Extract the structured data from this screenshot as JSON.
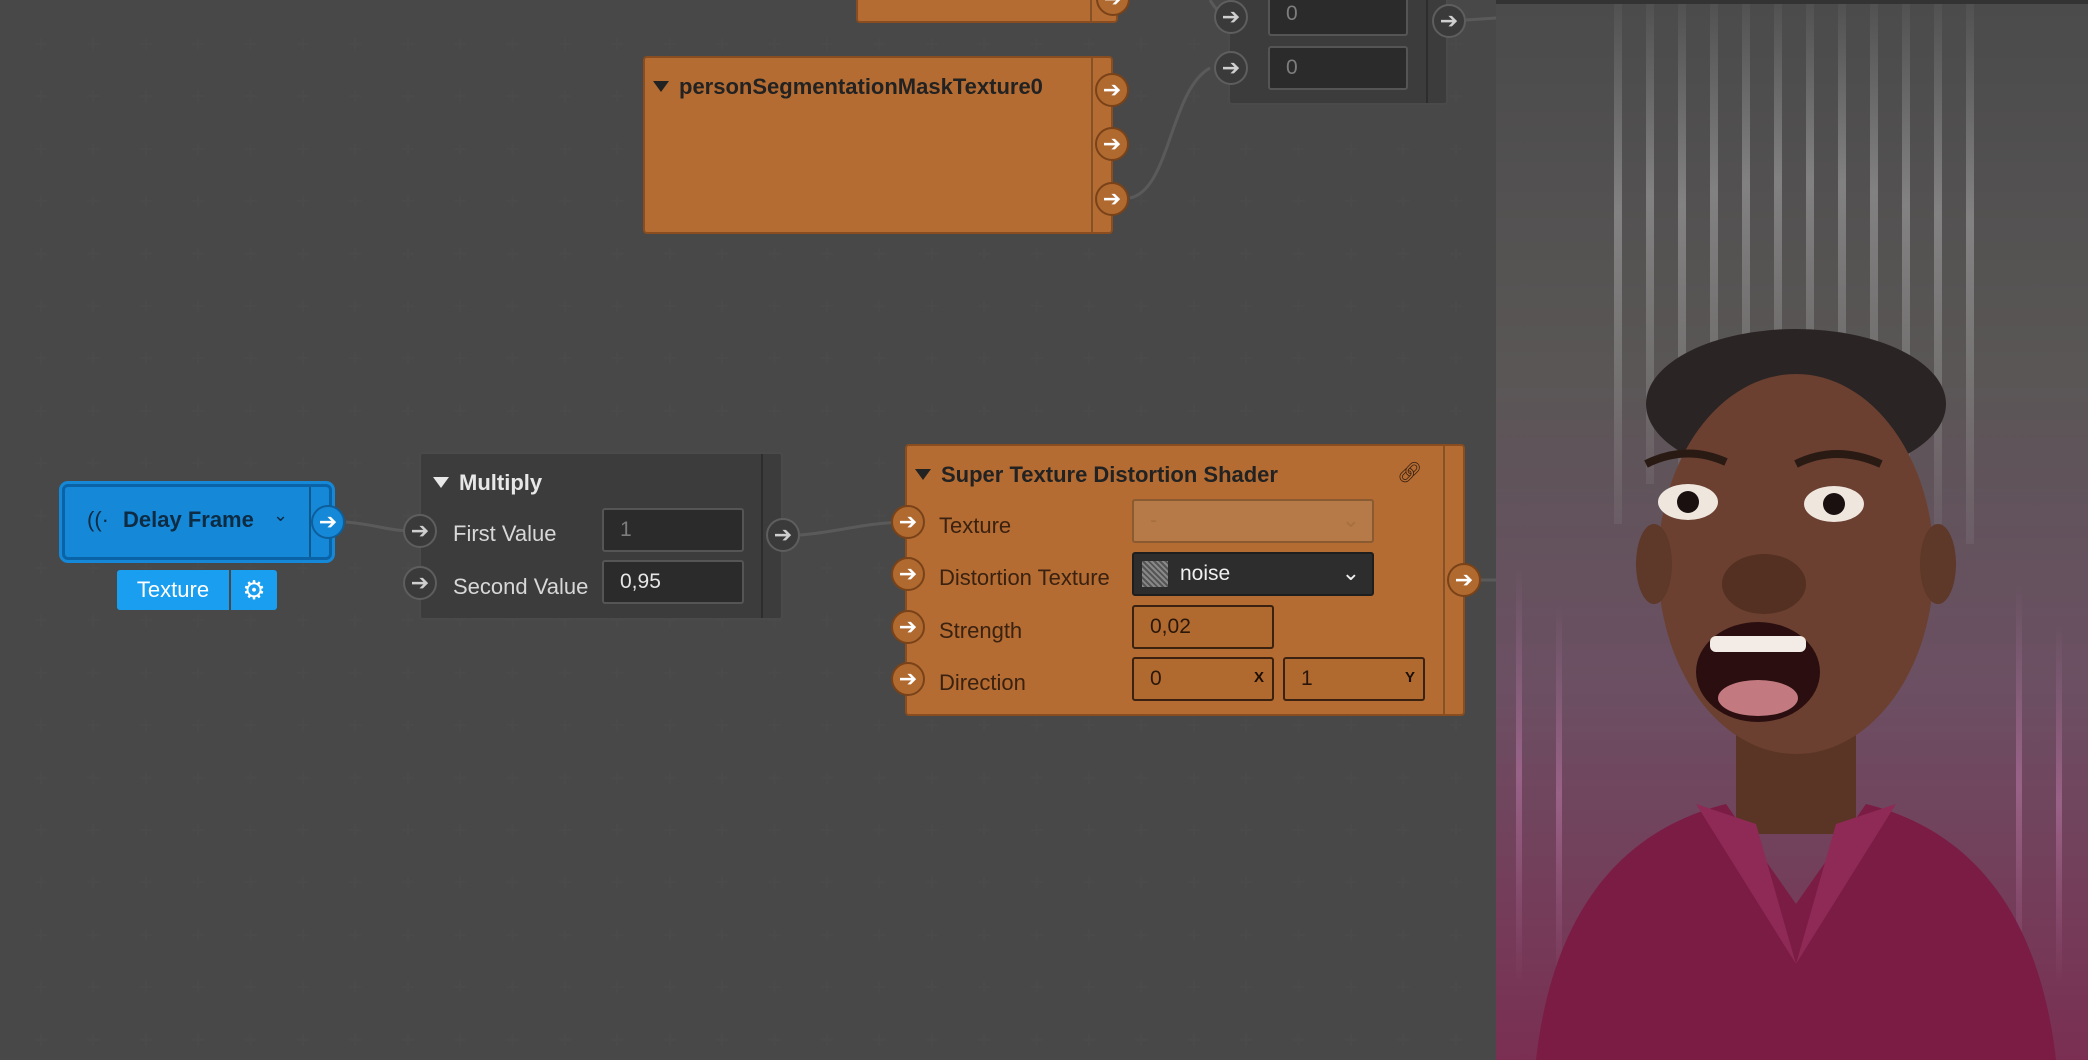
{
  "top_partial": {
    "field_a": "0",
    "field_b": "0"
  },
  "mask_node": {
    "title": "personSegmentationMaskTexture0"
  },
  "delay_frame": {
    "title": "Delay Frame",
    "chip_label": "Texture"
  },
  "multiply": {
    "title": "Multiply",
    "first_label": "First Value",
    "first_value": "1",
    "second_label": "Second Value",
    "second_value": "0,95"
  },
  "shader": {
    "title": "Super Texture Distortion Shader",
    "texture_label": "Texture",
    "texture_value": "-",
    "distortion_label": "Distortion Texture",
    "distortion_value": "noise",
    "strength_label": "Strength",
    "strength_value": "0,02",
    "direction_label": "Direction",
    "direction_x": "0",
    "direction_x_axis": "X",
    "direction_y": "1",
    "direction_y_axis": "Y"
  },
  "colors": {
    "canvas_bg": "#333333",
    "node_orange": "#b46c33",
    "node_blue": "#1589d8",
    "node_gray": "#3c3c3c"
  },
  "icons": {
    "port": "arrow-right-icon",
    "collapse": "triangle-down-icon",
    "link": "link-icon",
    "settings": "gear-icon",
    "delay": "signal-waves-icon",
    "dropdown": "chevron-down-icon"
  }
}
